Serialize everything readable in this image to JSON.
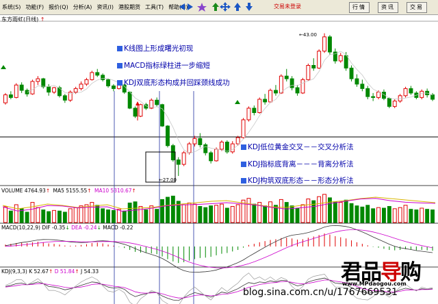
{
  "menubar": {
    "items": [
      "系统(S)",
      "功能(F)",
      "报价(Q)",
      "分析(A)",
      "资讯(I)",
      "港股期货",
      "工具(T)",
      "帮助(H)"
    ],
    "login_status": "交易未登录",
    "buttons": [
      "行情",
      "资讯",
      "交易"
    ]
  },
  "stock": {
    "name": "东方雨虹(日线)",
    "arrow": "↑"
  },
  "annotations_top": [
    "K线图上形成曙光初现",
    "MACD指标绿柱进一步缩短",
    "KDJ双底形态构成并回踩颈线成功"
  ],
  "annotations_bottom": [
    "KDJ低位黄金交叉－－交叉分析法",
    "KDJ指标底背离－－－背离分析法",
    "KDJ构筑双底形态－－形态分析法"
  ],
  "price_high": "43.00",
  "price_low": "27.00",
  "volume_panel": {
    "label": "VOLUME 4764.93",
    "ma5": "MA5 5155.55",
    "ma10": "MA10 5310.67"
  },
  "macd_panel": {
    "label": "MACD(10,22,9)",
    "dif": "DIF -0.35",
    "dea": "DEA -0.24",
    "macd": "MACD -0.22"
  },
  "kdj_panel": {
    "label": "KDJ(9,3,3)",
    "k": "K 52.67",
    "d": "D 51.84",
    "j": "J 54.33"
  },
  "watermark": {
    "logo_black1": "君品",
    "logo_red": "导",
    "logo_black2": "购",
    "site": "www.MPdaogou.com",
    "blog": "blog.sina.com.cn/u/1767669531"
  },
  "colors": {
    "up": "#e00000",
    "down": "#008800",
    "blue": "#0000aa",
    "ma_yellow": "#d8b400",
    "ma_magenta": "#cc00cc"
  },
  "chart_data": {
    "type": "candlestick",
    "candles": [
      [
        35.2,
        36.3,
        35.0,
        36.1
      ],
      [
        36.1,
        36.5,
        35.6,
        35.8
      ],
      [
        35.8,
        37.4,
        35.7,
        37.2
      ],
      [
        37.2,
        37.5,
        36.3,
        36.6
      ],
      [
        36.6,
        36.8,
        35.9,
        36.2
      ],
      [
        36.2,
        37.8,
        36.1,
        37.6
      ],
      [
        37.6,
        38.2,
        37.2,
        37.9
      ],
      [
        37.9,
        38.0,
        36.8,
        37.0
      ],
      [
        37.0,
        37.3,
        36.0,
        36.4
      ],
      [
        36.4,
        37.0,
        36.2,
        36.9
      ],
      [
        36.9,
        37.1,
        35.8,
        36.0
      ],
      [
        36.0,
        36.2,
        35.2,
        35.5
      ],
      [
        35.5,
        36.6,
        35.3,
        36.4
      ],
      [
        36.4,
        37.0,
        36.2,
        36.8
      ],
      [
        36.8,
        37.6,
        36.6,
        37.3
      ],
      [
        37.3,
        38.0,
        37.1,
        37.8
      ],
      [
        37.8,
        38.8,
        37.7,
        38.6
      ],
      [
        38.6,
        39.0,
        38.1,
        38.3
      ],
      [
        38.3,
        38.5,
        37.6,
        37.8
      ],
      [
        37.8,
        37.9,
        36.9,
        37.1
      ],
      [
        37.1,
        37.3,
        36.5,
        36.8
      ],
      [
        36.8,
        37.4,
        36.7,
        37.2
      ],
      [
        37.2,
        37.3,
        36.2,
        36.4
      ],
      [
        36.4,
        36.5,
        34.5,
        34.6
      ],
      [
        34.6,
        34.8,
        33.5,
        33.7
      ],
      [
        33.7,
        35.1,
        33.6,
        35.0
      ],
      [
        35.0,
        35.2,
        34.4,
        34.6
      ],
      [
        34.6,
        35.7,
        34.5,
        35.5
      ],
      [
        35.5,
        35.8,
        34.8,
        35.0
      ],
      [
        35.0,
        35.1,
        32.5,
        32.6
      ],
      [
        32.6,
        32.7,
        30.2,
        30.4
      ],
      [
        30.4,
        30.6,
        28.6,
        28.8
      ],
      [
        28.8,
        29.1,
        27.0,
        28.3
      ],
      [
        28.3,
        29.8,
        28.1,
        29.6
      ],
      [
        29.6,
        30.8,
        29.4,
        30.6
      ],
      [
        30.6,
        31.5,
        30.3,
        31.2
      ],
      [
        31.2,
        31.8,
        30.2,
        30.5
      ],
      [
        30.5,
        30.7,
        29.3,
        29.6
      ],
      [
        29.6,
        29.8,
        28.4,
        28.7
      ],
      [
        28.7,
        30.2,
        28.6,
        30.0
      ],
      [
        30.0,
        31.0,
        29.8,
        30.8
      ],
      [
        30.8,
        31.0,
        29.5,
        29.7
      ],
      [
        29.7,
        30.9,
        29.5,
        30.6
      ],
      [
        30.6,
        31.5,
        30.4,
        31.3
      ],
      [
        31.3,
        33.5,
        31.2,
        33.3
      ],
      [
        33.3,
        34.8,
        33.1,
        34.6
      ],
      [
        34.6,
        34.9,
        33.8,
        34.1
      ],
      [
        34.1,
        35.8,
        34.0,
        35.6
      ],
      [
        35.6,
        36.2,
        35.0,
        35.3
      ],
      [
        35.3,
        36.8,
        35.2,
        36.6
      ],
      [
        36.6,
        37.2,
        36.0,
        36.3
      ],
      [
        36.3,
        38.4,
        36.2,
        38.2
      ],
      [
        38.2,
        39.0,
        37.6,
        37.9
      ],
      [
        37.9,
        38.2,
        36.6,
        36.9
      ],
      [
        36.9,
        37.2,
        36.0,
        36.3
      ],
      [
        36.3,
        38.0,
        36.2,
        37.8
      ],
      [
        37.8,
        39.6,
        37.7,
        39.4
      ],
      [
        39.4,
        40.2,
        38.8,
        39.1
      ],
      [
        39.1,
        41.2,
        39.0,
        41.0
      ],
      [
        41.0,
        43.0,
        40.8,
        42.6
      ],
      [
        42.6,
        42.8,
        40.6,
        40.9
      ],
      [
        40.9,
        41.3,
        39.6,
        39.9
      ],
      [
        39.9,
        40.8,
        39.7,
        40.5
      ],
      [
        40.5,
        40.9,
        38.8,
        39.1
      ],
      [
        39.1,
        39.4,
        37.6,
        37.9
      ],
      [
        37.9,
        38.4,
        37.0,
        37.3
      ],
      [
        37.3,
        37.8,
        36.5,
        36.8
      ],
      [
        36.8,
        37.1,
        35.6,
        35.9
      ],
      [
        35.9,
        36.3,
        35.4,
        35.8
      ],
      [
        35.8,
        36.6,
        35.6,
        36.4
      ],
      [
        36.4,
        36.7,
        35.5,
        35.7
      ],
      [
        35.7,
        35.8,
        34.6,
        34.8
      ],
      [
        34.8,
        35.6,
        34.6,
        35.4
      ],
      [
        35.4,
        36.2,
        35.2,
        36.0
      ],
      [
        36.0,
        37.0,
        35.8,
        36.8
      ],
      [
        36.8,
        37.1,
        36.1,
        36.3
      ],
      [
        36.3,
        36.5,
        35.6,
        35.8
      ],
      [
        35.8,
        36.7,
        35.6,
        36.5
      ],
      [
        36.5,
        36.8,
        35.8,
        36.1
      ],
      [
        36.1,
        36.3,
        35.4,
        35.6
      ]
    ],
    "volume": [
      55,
      40,
      62,
      48,
      36,
      70,
      52,
      44,
      38,
      42,
      40,
      36,
      48,
      52,
      58,
      62,
      70,
      60,
      48,
      44,
      42,
      46,
      40,
      68,
      72,
      56,
      44,
      58,
      46,
      80,
      88,
      92,
      74,
      62,
      68,
      64,
      56,
      52,
      58,
      60,
      64,
      50,
      56,
      62,
      78,
      84,
      64,
      70,
      58,
      72,
      60,
      80,
      70,
      58,
      50,
      62,
      82,
      76,
      90,
      98,
      86,
      72,
      70,
      78,
      66,
      58,
      54,
      60,
      48,
      52,
      50,
      56,
      48,
      52,
      60,
      46,
      44,
      50,
      46,
      44
    ],
    "volume_ma_y": [
      300,
      305,
      302,
      298,
      300,
      303,
      301,
      299,
      305,
      304,
      303,
      300,
      298,
      296,
      294,
      293,
      296,
      299,
      302,
      303,
      300,
      298,
      295,
      293,
      290,
      288,
      290,
      292,
      294,
      296
    ],
    "macd_hist": [
      0.1,
      0.14,
      0.18,
      0.2,
      0.18,
      0.22,
      0.25,
      0.22,
      0.16,
      0.14,
      0.1,
      0.05,
      0.04,
      0.05,
      0.08,
      0.12,
      0.18,
      0.2,
      0.16,
      0.1,
      0.04,
      -0.02,
      -0.08,
      -0.18,
      -0.28,
      -0.32,
      -0.34,
      -0.36,
      -0.4,
      -0.52,
      -0.66,
      -0.78,
      -0.86,
      -0.82,
      -0.74,
      -0.66,
      -0.6,
      -0.58,
      -0.54,
      -0.46,
      -0.38,
      -0.34,
      -0.26,
      -0.18,
      -0.06,
      0.08,
      0.14,
      0.22,
      0.28,
      0.34,
      0.38,
      0.44,
      0.46,
      0.42,
      0.36,
      0.38,
      0.46,
      0.52,
      0.6,
      0.68,
      0.62,
      0.54,
      0.48,
      0.42,
      0.32,
      0.22,
      0.14,
      0.06,
      -0.02,
      -0.06,
      -0.12,
      -0.18,
      -0.2,
      -0.18,
      -0.14,
      -0.16,
      -0.2,
      -0.18,
      -0.2,
      -0.22
    ],
    "kdj_k": [
      60,
      64,
      70,
      72,
      66,
      70,
      76,
      70,
      60,
      58,
      54,
      48,
      52,
      58,
      64,
      70,
      76,
      74,
      66,
      58,
      54,
      56,
      50,
      34,
      24,
      30,
      34,
      40,
      38,
      26,
      18,
      12,
      10,
      20,
      30,
      38,
      34,
      28,
      22,
      30,
      40,
      36,
      44,
      52,
      64,
      74,
      70,
      76,
      74,
      80,
      76,
      82,
      80,
      70,
      62,
      66,
      76,
      82,
      86,
      90,
      82,
      72,
      70,
      66,
      56,
      46,
      40,
      36,
      38,
      44,
      40,
      34,
      40,
      48,
      54,
      50,
      46,
      52,
      50,
      52
    ],
    "kdj_d": [
      58,
      60,
      63,
      66,
      66,
      67,
      70,
      70,
      67,
      64,
      61,
      57,
      55,
      56,
      58,
      62,
      67,
      69,
      68,
      65,
      61,
      59,
      56,
      49,
      41,
      37,
      36,
      37,
      38,
      34,
      28,
      23,
      19,
      19,
      23,
      28,
      30,
      29,
      27,
      28,
      32,
      33,
      37,
      42,
      49,
      57,
      62,
      67,
      70,
      73,
      74,
      77,
      78,
      75,
      71,
      69,
      71,
      75,
      79,
      83,
      83,
      79,
      76,
      73,
      67,
      60,
      53,
      48,
      45,
      45,
      43,
      40,
      40,
      43,
      47,
      48,
      47,
      49,
      49,
      50
    ]
  }
}
